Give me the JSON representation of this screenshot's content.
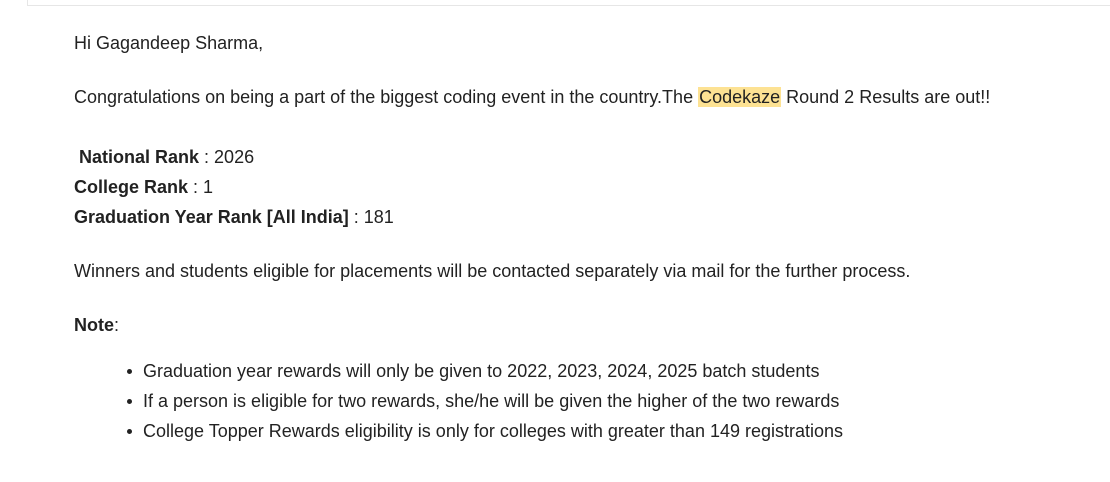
{
  "email": {
    "greeting": "Hi Gagandeep Sharma,",
    "intro_before": "Congratulations on being a part of the biggest coding event in the country.The ",
    "intro_highlight": "Codekaze",
    "intro_after": " Round 2 Results are out!!",
    "highlight_color": "#fde293",
    "ranks": [
      {
        "label": "National Rank",
        "separator": " : ",
        "value": "2026"
      },
      {
        "label": "College Rank",
        "separator": " : ",
        "value": "1"
      },
      {
        "label": "Graduation Year Rank [All India]",
        "separator": " : ",
        "value": "181"
      }
    ],
    "winners_text": "Winners and students eligible for placements will be contacted separately via mail for the further process.",
    "note_label": "Note",
    "note_suffix": ":",
    "notes": [
      "Graduation year rewards will only be given to 2022, 2023, 2024, 2025 batch students",
      "If a person is eligible for two rewards, she/he will be given the higher of the two rewards",
      "College Topper Rewards eligibility is only for colleges with greater than 149 registrations"
    ]
  }
}
